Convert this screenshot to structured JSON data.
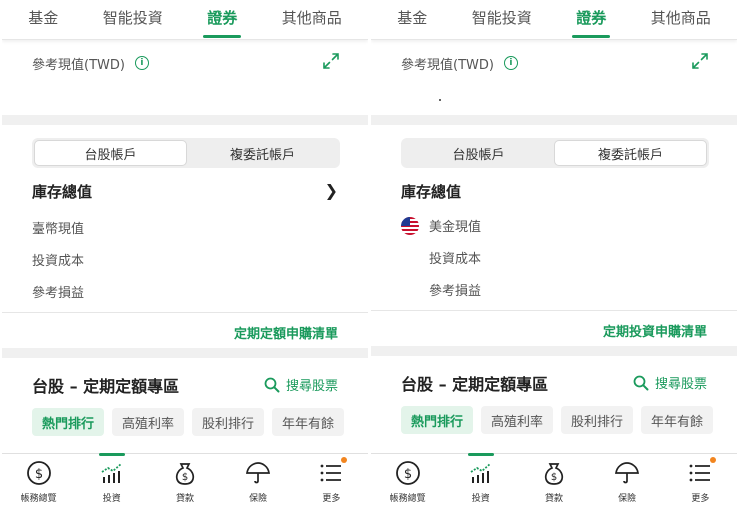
{
  "colors": {
    "accent": "#1a9a5c",
    "notify": "#f2851f"
  },
  "panels": [
    {
      "tabs": [
        {
          "label": "基金"
        },
        {
          "label": "智能投資"
        },
        {
          "label": "證券"
        },
        {
          "label": "其他商品"
        }
      ],
      "active_tab": 2,
      "reference_label": "參考現值(TWD)",
      "segment": [
        {
          "label": "台股帳戶"
        },
        {
          "label": "複委託帳戶"
        }
      ],
      "active_segment": 0,
      "inventory_title": "庫存總值",
      "inventory_rows": [
        {
          "label": "臺幣現值"
        },
        {
          "label": "投資成本"
        },
        {
          "label": "參考損益"
        }
      ],
      "list_link": "定期定額申購清單",
      "zone_title": "台股 – 定期定額專區",
      "search_label": "搜尋股票",
      "chips": [
        {
          "label": "熱門排行"
        },
        {
          "label": "高殖利率"
        },
        {
          "label": "股利排行"
        },
        {
          "label": "年年有餘"
        }
      ],
      "nav": [
        {
          "label": "帳務總覽",
          "icon": "dollar-circle-icon"
        },
        {
          "label": "投資",
          "icon": "chart-up-icon"
        },
        {
          "label": "貸款",
          "icon": "money-bag-icon"
        },
        {
          "label": "保險",
          "icon": "umbrella-icon"
        },
        {
          "label": "更多",
          "icon": "menu-icon"
        }
      ]
    },
    {
      "tabs": [
        {
          "label": "基金"
        },
        {
          "label": "智能投資"
        },
        {
          "label": "證券"
        },
        {
          "label": "其他商品"
        }
      ],
      "active_tab": 2,
      "reference_label": "參考現值(TWD)",
      "segment": [
        {
          "label": "台股帳戶"
        },
        {
          "label": "複委託帳戶"
        }
      ],
      "active_segment": 1,
      "inventory_title": "庫存總值",
      "inventory_rows": [
        {
          "label": "美金現值",
          "flag": "us-flag-icon"
        },
        {
          "label": "投資成本"
        },
        {
          "label": "參考損益"
        }
      ],
      "list_link": "定期投資申購清單",
      "zone_title": "台股 – 定期定額專區",
      "search_label": "搜尋股票",
      "chips": [
        {
          "label": "熱門排行"
        },
        {
          "label": "高殖利率"
        },
        {
          "label": "股利排行"
        },
        {
          "label": "年年有餘"
        }
      ],
      "nav": [
        {
          "label": "帳務總覽",
          "icon": "dollar-circle-icon"
        },
        {
          "label": "投資",
          "icon": "chart-up-icon"
        },
        {
          "label": "貸款",
          "icon": "money-bag-icon"
        },
        {
          "label": "保險",
          "icon": "umbrella-icon"
        },
        {
          "label": "更多",
          "icon": "menu-icon"
        }
      ]
    }
  ]
}
